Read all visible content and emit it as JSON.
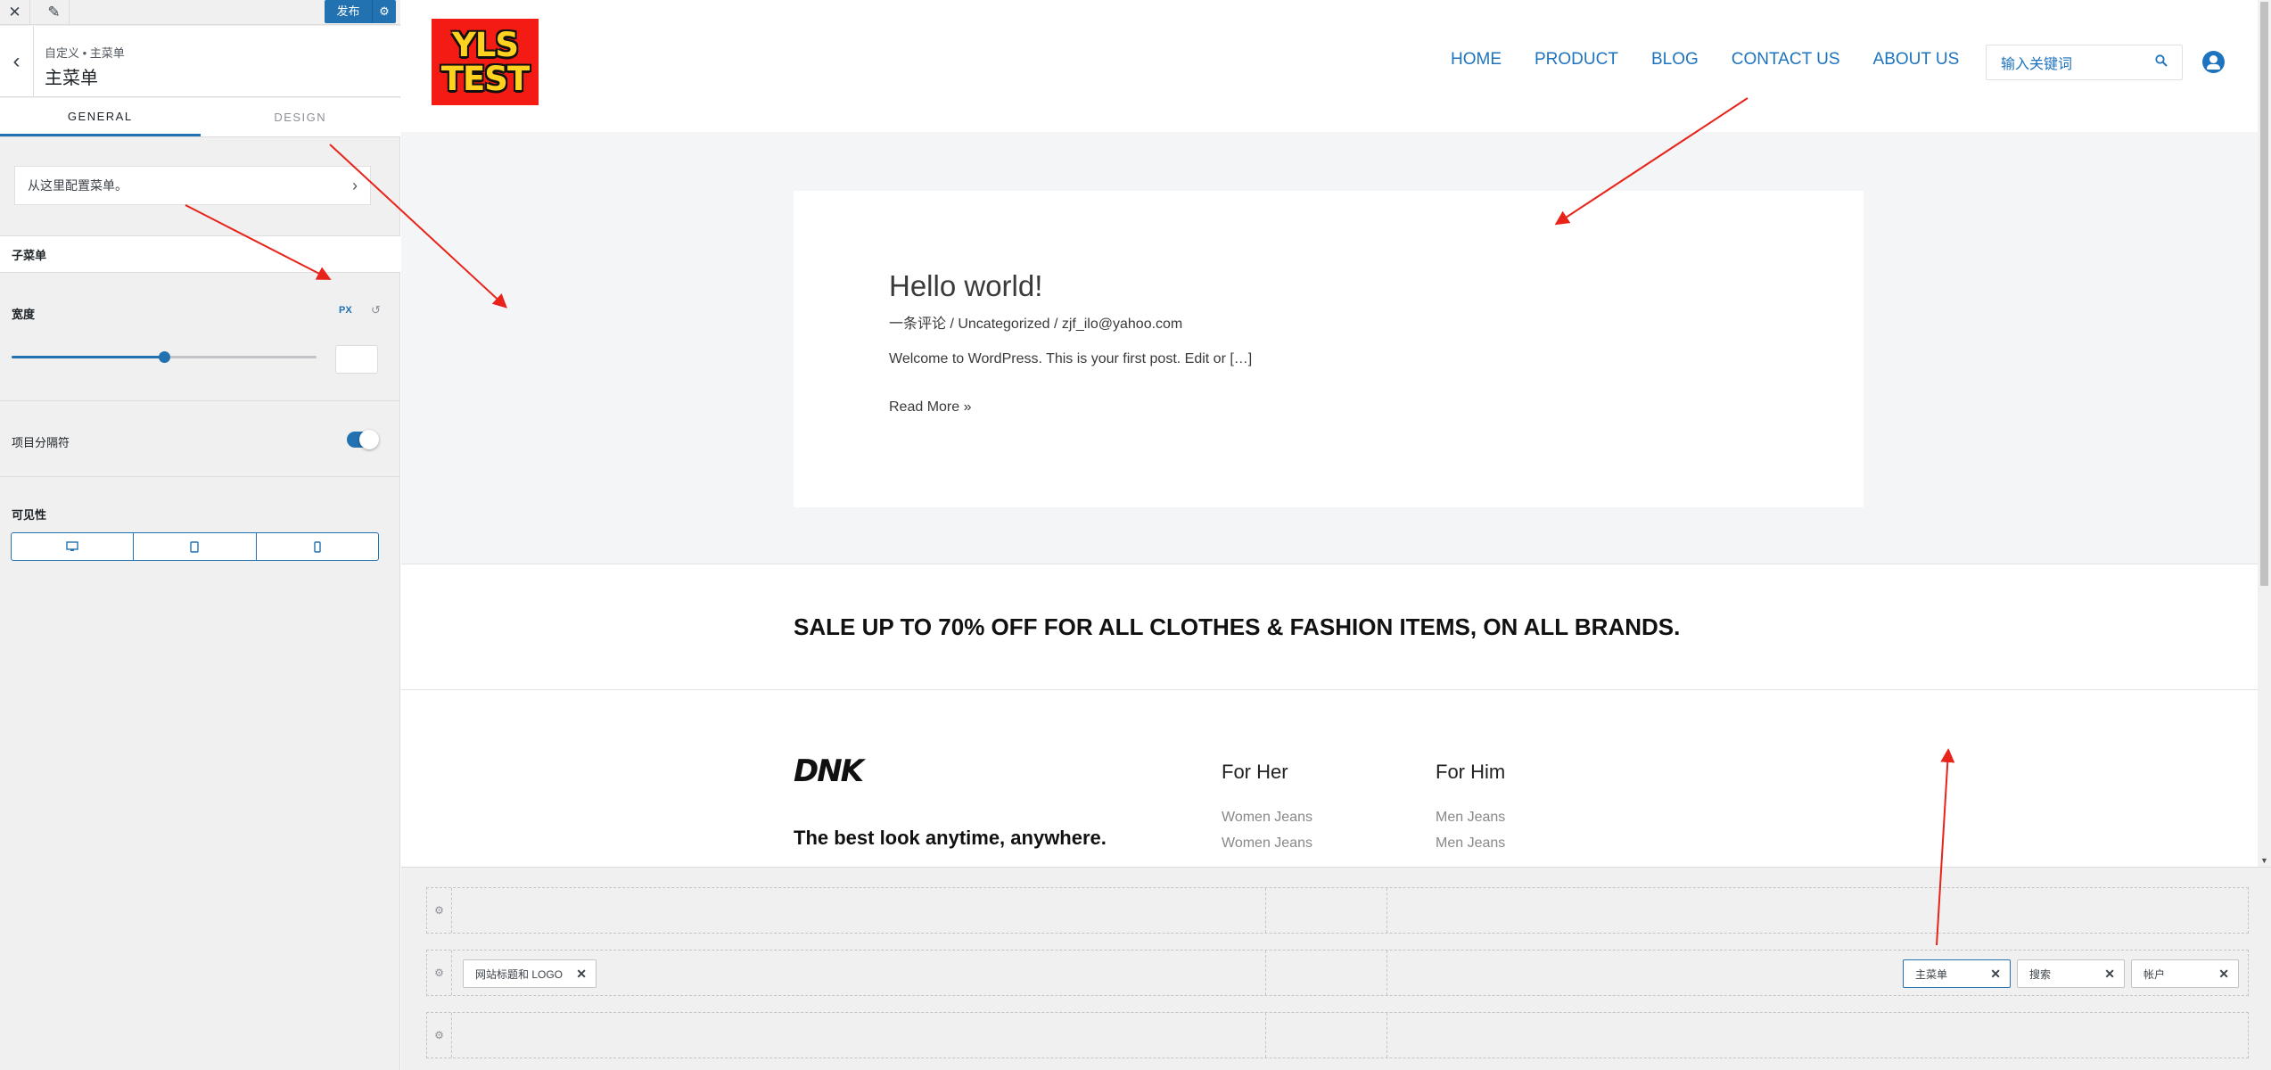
{
  "topbar": {
    "close_icon": "close-icon",
    "edit_icon": "pencil-icon",
    "publish_label": "发布",
    "publish_gear_icon": "gear-icon"
  },
  "section": {
    "breadcrumb": "自定义 • 主菜单",
    "title": "主菜单"
  },
  "tabs": [
    {
      "label": "GENERAL",
      "active": true
    },
    {
      "label": "DESIGN",
      "active": false
    }
  ],
  "configure_menu": {
    "label": "从这里配置菜单。"
  },
  "submenu": {
    "heading": "子菜单",
    "width_label": "宽度",
    "unit": "PX",
    "slider_fraction": 0.5,
    "width_value": ""
  },
  "divider": {
    "label": "项目分隔符",
    "enabled": true
  },
  "visibility": {
    "label": "可见性",
    "devices": [
      "desktop-icon",
      "tablet-icon",
      "mobile-icon"
    ]
  },
  "site": {
    "logo_line1": "YLS",
    "logo_line2": "TEST",
    "logo_bg": "#f31b14",
    "nav": [
      "HOME",
      "PRODUCT",
      "BLOG",
      "CONTACT US",
      "ABOUT US"
    ],
    "search_placeholder": "输入关键词",
    "accent": "#1e73be"
  },
  "post": {
    "title": "Hello world!",
    "meta": "一条评论 / Uncategorized / zjf_ilo@yahoo.com",
    "excerpt": "Welcome to WordPress. This is your first post. Edit or […]",
    "read_more": "Read More »"
  },
  "sale": {
    "text": "SALE UP TO 70% OFF FOR ALL CLOTHES & FASHION ITEMS, ON ALL BRANDS."
  },
  "footer": {
    "brand": "DNK",
    "tagline": "The best look anytime, anywhere.",
    "columns": [
      {
        "title": "For Her",
        "items": [
          "Women Jeans",
          "Women Jeans"
        ]
      },
      {
        "title": "For Him",
        "items": [
          "Men Jeans",
          "Men Jeans"
        ]
      }
    ]
  },
  "builder": {
    "chips": [
      {
        "label": "网站标题和 LOGO"
      },
      {
        "label": "主菜单",
        "active": true
      },
      {
        "label": "搜索"
      },
      {
        "label": "帐户"
      }
    ],
    "remove_symbol": "✕"
  },
  "colors": {
    "primary": "#2271b1",
    "annotation": "#e8231a"
  }
}
